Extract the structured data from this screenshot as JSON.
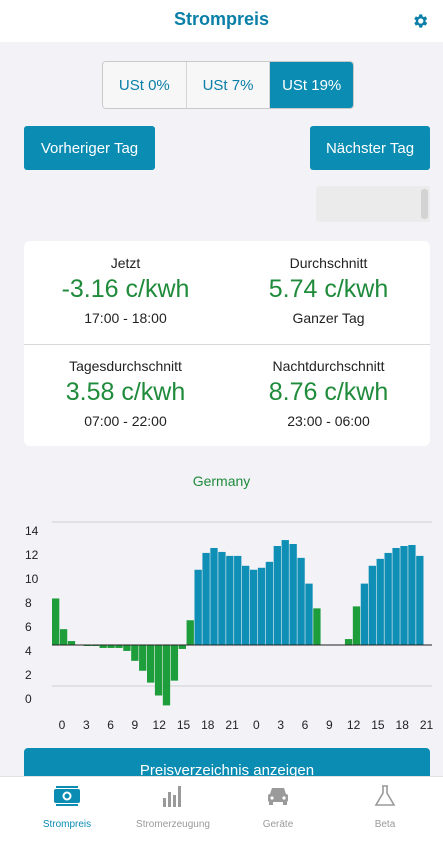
{
  "header": {
    "title": "Strompreis"
  },
  "vat_segments": [
    {
      "label": "USt 0%",
      "active": false
    },
    {
      "label": "USt 7%",
      "active": false
    },
    {
      "label": "USt 19%",
      "active": true
    }
  ],
  "nav": {
    "prev_label": "Vorheriger Tag",
    "next_label": "Nächster Tag"
  },
  "stats": {
    "now": {
      "label": "Jetzt",
      "value": "-3.16 c/kwh",
      "sub": "17:00 - 18:00"
    },
    "average": {
      "label": "Durchschnitt",
      "value": "5.74 c/kwh",
      "sub": "Ganzer Tag"
    },
    "day_average": {
      "label": "Tagesdurchschnitt",
      "value": "3.58 c/kwh",
      "sub": "07:00 - 22:00"
    },
    "night_average": {
      "label": "Nachtdurchschnitt",
      "value": "8.76 c/kwh",
      "sub": "23:00 - 06:00"
    }
  },
  "chart_data": {
    "type": "bar",
    "title": "Germany",
    "xlabel": "",
    "ylabel": "",
    "y_tick_labels": [
      "14",
      "12",
      "10",
      "8",
      "6",
      "4",
      "2",
      "0"
    ],
    "x_tick_labels": [
      "0",
      "3",
      "6",
      "9",
      "12",
      "15",
      "18",
      "21",
      "0",
      "3",
      "6",
      "9",
      "12",
      "15",
      "18",
      "21"
    ],
    "x": [
      0,
      1,
      2,
      3,
      4,
      5,
      6,
      7,
      8,
      9,
      10,
      11,
      12,
      13,
      14,
      15,
      16,
      17,
      18,
      19,
      20,
      21,
      22,
      23,
      24,
      25,
      26,
      27,
      28,
      29,
      30,
      31,
      32,
      33,
      34,
      35,
      36,
      37,
      38,
      39,
      40,
      41,
      42,
      43,
      44,
      45,
      46,
      47
    ],
    "values": [
      4.7,
      1.6,
      0.4,
      0,
      -0.1,
      -0.1,
      -0.3,
      -0.3,
      -0.3,
      -0.6,
      -1.6,
      -2.6,
      -3.8,
      -5.1,
      -6.1,
      -3.6,
      -0.4,
      2.5,
      7.6,
      9.3,
      9.8,
      9.4,
      9.0,
      9.0,
      8.0,
      7.6,
      7.8,
      8.4,
      10.0,
      10.6,
      10.2,
      8.8,
      6.2,
      3.7,
      0,
      0,
      0,
      0.6,
      3.9,
      6.2,
      8.0,
      8.7,
      9.3,
      9.8,
      10.0,
      10.1,
      9.0,
      0
    ],
    "colors": {
      "negative_or_low": "#1e9e3b",
      "high": "#0f8fb6",
      "rule": "#222222"
    }
  },
  "list_button": {
    "label": "Preisverzeichnis anzeigen"
  },
  "tabbar": [
    {
      "label": "Strompreis",
      "icon": "money-icon",
      "active": true
    },
    {
      "label": "Stromerzeugung",
      "icon": "bar-chart-icon",
      "active": false
    },
    {
      "label": "Geräte",
      "icon": "car-icon",
      "active": false
    },
    {
      "label": "Beta",
      "icon": "flask-icon",
      "active": false
    }
  ],
  "colors": {
    "accent": "#0b8cb3",
    "title": "#0b7fa8",
    "green_value": "#1f8b3b"
  }
}
